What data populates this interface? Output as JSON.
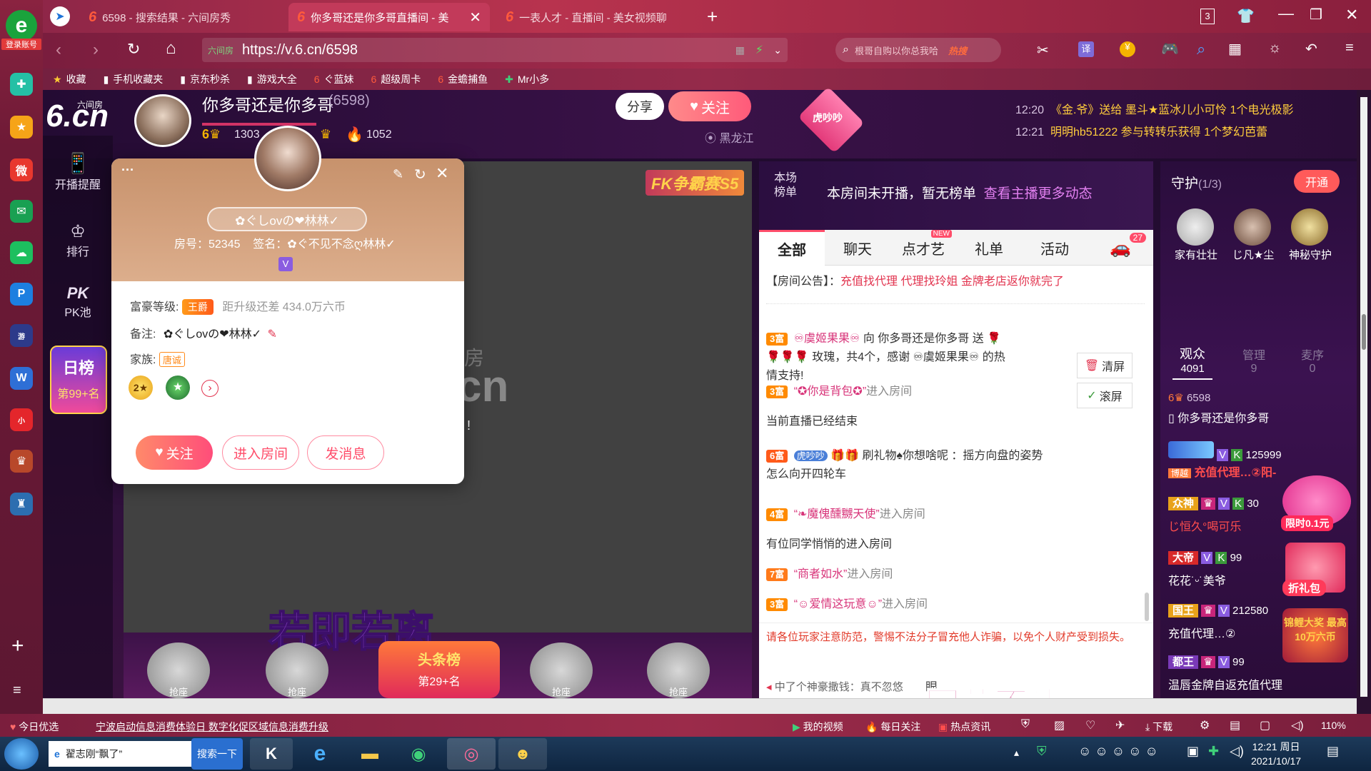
{
  "browser": {
    "tabs": [
      {
        "label": "6598 - 搜索结果 - 六间房秀"
      },
      {
        "label": "你多哥还是你多哥直播间 - 美"
      },
      {
        "label": "一表人才 - 直播间 - 美女视频聊"
      }
    ],
    "tab_count": "3",
    "url": "https://v.6.cn/6598",
    "url_prefix": "六间房",
    "search_placeholder": "根哥自购以你总我哈",
    "search_hot": "热搜",
    "login_label": "登录账号",
    "bookmarks": [
      "收藏",
      "手机收藏夹",
      "京东秒杀",
      "游戏大全",
      "ぐ蓝妹",
      "超级周卡",
      "金蟾捕鱼",
      "Mr小多"
    ]
  },
  "site": {
    "logo": "6.cn",
    "logo_sub": "六间房",
    "nav": [
      {
        "label": "开播提醒"
      },
      {
        "label": "排行"
      },
      {
        "label": "PK池"
      }
    ],
    "daily_rank": {
      "label": "日榜",
      "rank": "第99+名"
    }
  },
  "host": {
    "name": "你多哥还是你多哥",
    "room_id": "(6598)",
    "fans": "1303",
    "hot": "1052",
    "location": "黑龙江",
    "share_label": "分享",
    "follow_label": "关注",
    "tiger": "虎吵吵"
  },
  "broadcast": [
    {
      "time": "12:20",
      "text": "《金.爷》送给 墨斗★蓝冰儿小可怜 1个电光极影"
    },
    {
      "time": "12:21",
      "text": "明明hb51222 参与转转乐获得 1个梦幻芭蕾"
    }
  ],
  "popup": {
    "nickname": "✿ぐしovの❤林林✓",
    "room_label": "房号：52345",
    "sign_label": "签名：✿ぐ不见不念ღ林林✓",
    "vip_badge": "V",
    "wealth_label": "富豪等级:",
    "wealth_badge": "王爵",
    "wealth_upgrade": "距升级还差 434.0万六币",
    "remark_label": "备注:",
    "remark_value": "✿ぐしovの❤林林✓",
    "family_label": "家族:",
    "family_badge": "唐诚",
    "follow_btn": "关注",
    "enter_btn": "进入房间",
    "msg_btn": "发消息",
    "more": "···"
  },
  "video": {
    "event_badge": "FK争霸赛S5",
    "overlay_big": "若即若离",
    "head_rank": "头条榜",
    "head_rank_sub": "第29+名",
    "seat_label": "抢座"
  },
  "chat": {
    "rank_label": "本场榜单",
    "no_rank": "本房间未开播，暂无榜单",
    "more_link": "查看主播更多动态",
    "tabs": [
      "全部",
      "聊天",
      "点才艺",
      "礼单",
      "活动"
    ],
    "tab_new": "NEW",
    "car_count": "27",
    "notice_label": "【房间公告】：",
    "notice": "充值找代理 代理找玲姐 金牌老店返你就完了",
    "clear_label": "清屏",
    "scroll_label": "滚屏",
    "messages": [
      {
        "lvl": "3富",
        "user": "♾虞姬果果♾",
        "text": "向 你多哥还是你多哥 送",
        "gift": "玫瑰，共4个，感谢 ♾虞姬果果♾ 的热情支持!"
      },
      {
        "lvl": "3富",
        "user": "“✪你是背包✪”",
        "text": "进入房间"
      },
      {
        "lvl": "",
        "user": "",
        "text": "当前直播已经结束"
      },
      {
        "lvl": "6富",
        "user": "虎吵吵",
        "text": "刷礼物♠你想啥呢 ：摇方向盘的姿势怎么向开四轮车"
      },
      {
        "lvl": "4富",
        "user": "“❧魔傀醺嬲天使”",
        "text": "进入房间"
      },
      {
        "lvl": "",
        "user": "",
        "text": "有位同学悄悄的进入房间"
      },
      {
        "lvl": "7富",
        "user": "“商者如水”",
        "text": "进入房间"
      },
      {
        "lvl": "3富",
        "user": "“☺爱情这玩意☺”",
        "text": "进入房间"
      }
    ],
    "warning": "请各位玩家注意防范，警惕不法分子冒充他人诈骗，以免个人财产受到损失。",
    "ticker": "中了个神豪撒钱：真不忽悠",
    "ticker_end": "眼",
    "overlay_text": "回荡不清"
  },
  "guard": {
    "title": "守护",
    "count": "(1/3)",
    "open_btn": "开通",
    "members": [
      "家有壮壮",
      "じ凡★尘",
      "神秘守护"
    ],
    "tabs": [
      {
        "label": "观众",
        "count": "4091"
      },
      {
        "label": "管理",
        "count": "9"
      },
      {
        "label": "麦序",
        "count": "0"
      }
    ],
    "audience": [
      {
        "name": "你多哥还是你多哥",
        "id": "6598"
      },
      {
        "name": "充值代理…②阳-",
        "id": "125999",
        "tag": "博越"
      },
      {
        "name": "じ恒久°喝可乐",
        "id": "30",
        "tag": "众神"
      },
      {
        "name": "花花˙ᵕ˙美爷",
        "id": "99",
        "tag": "大帝"
      },
      {
        "name": "充值代理…②",
        "id": "212580",
        "tag": "国王"
      },
      {
        "name": "温唇金牌自返充值代理",
        "id": "99",
        "tag": "都王"
      }
    ],
    "promo1": "限时0.1元",
    "promo2": "折礼包",
    "promo3": "锦鲤大奖 最高10万六币"
  },
  "statusbar": {
    "items": [
      "今日优选",
      "宁波启动信息消费体验日 数字化促区域信息消费升级",
      "我的视频",
      "每日关注",
      "热点资讯",
      "下载"
    ],
    "zoom": "110%"
  },
  "taskbar": {
    "search_text": "翟志刚“飘了”",
    "search_btn": "搜索一下",
    "time": "12:21 周日",
    "date": "2021/10/17"
  }
}
